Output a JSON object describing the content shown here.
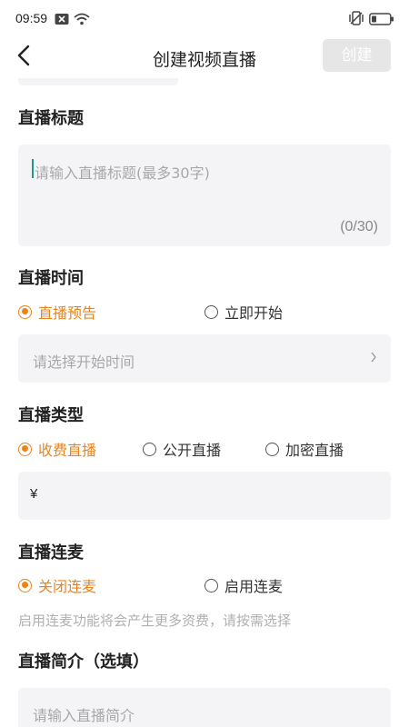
{
  "status_bar": {
    "time": "09:59",
    "icons": [
      "notification-x-icon",
      "wifi-icon",
      "vibrate-icon",
      "battery-icon"
    ]
  },
  "header": {
    "title": "创建视频直播",
    "create_label": "创建",
    "back_icon": "chevron-left-icon"
  },
  "title_section": {
    "label": "直播标题",
    "placeholder": "请输入直播标题(最多30字)",
    "counter": "(0/30)"
  },
  "time_section": {
    "label": "直播时间",
    "options": [
      "直播预告",
      "立即开始"
    ],
    "selected": 0,
    "picker_placeholder": "请选择开始时间"
  },
  "type_section": {
    "label": "直播类型",
    "options": [
      "收费直播",
      "公开直播",
      "加密直播"
    ],
    "selected": 0,
    "currency": "¥"
  },
  "mic_section": {
    "label": "直播连麦",
    "options": [
      "关闭连麦",
      "启用连麦"
    ],
    "selected": 0,
    "hint": "启用连麦功能将会产生更多资费，请按需选择"
  },
  "intro_section": {
    "label": "直播简介（选填）",
    "placeholder": "请输入直播简介"
  },
  "colors": {
    "accent": "#e8841c",
    "field_bg": "#f4f4f6",
    "disabled_button": "#e6e6e6",
    "caret": "#1f9a8a"
  }
}
